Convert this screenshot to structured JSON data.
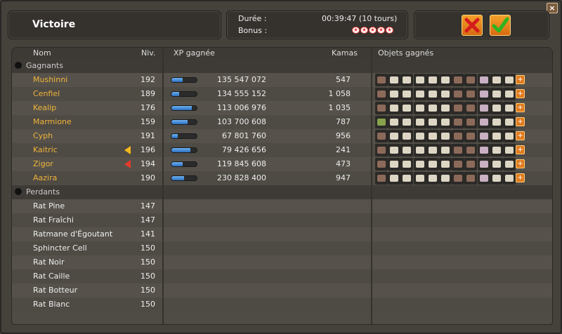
{
  "header": {
    "title": "Victoire",
    "duration_label": "Durée :",
    "duration_value": "00:39:47 (10 tours)",
    "bonus_label": "Bonus :",
    "stars": 5
  },
  "columns": {
    "name": "Nom",
    "level": "Niv.",
    "xp": "XP gagnée",
    "kamas": "Kamas",
    "items": "Objets gagnés"
  },
  "winners_label": "Gagnants",
  "losers_label": "Perdants",
  "winners": [
    {
      "name": "Mushinni",
      "level": "192",
      "xp": "135 547 072",
      "kamas": "547",
      "xp_fill": 0.45
    },
    {
      "name": "Cenfiel",
      "level": "189",
      "xp": "134 555 152",
      "kamas": "1 058",
      "xp_fill": 0.3
    },
    {
      "name": "Kealip",
      "level": "176",
      "xp": "113 006 976",
      "kamas": "1 035",
      "xp_fill": 0.8
    },
    {
      "name": "Marmione",
      "level": "159",
      "xp": "103 700 608",
      "kamas": "787",
      "xp_fill": 0.65
    },
    {
      "name": "Cyph",
      "level": "191",
      "xp": "67 801 760",
      "kamas": "956",
      "xp_fill": 0.25
    },
    {
      "name": "Kaitric",
      "level": "196",
      "xp": "79 426 656",
      "kamas": "241",
      "xp_fill": 0.75,
      "arrow": "yellow"
    },
    {
      "name": "Zigor",
      "level": "194",
      "xp": "119 845 608",
      "kamas": "473",
      "xp_fill": 0.45,
      "arrow": "red"
    },
    {
      "name": "Aazira",
      "level": "190",
      "xp": "230 828 400",
      "kamas": "947",
      "xp_fill": 0.5
    }
  ],
  "losers": [
    {
      "name": "Rat Pine",
      "level": "147"
    },
    {
      "name": "Rat Fraîchi",
      "level": "147"
    },
    {
      "name": "Ratmane d'Égoutant",
      "level": "141"
    },
    {
      "name": "Sphincter Cell",
      "level": "150"
    },
    {
      "name": "Rat Noir",
      "level": "150"
    },
    {
      "name": "Rat Caille",
      "level": "150"
    },
    {
      "name": "Rat Botteur",
      "level": "150"
    },
    {
      "name": "Rat Blanc",
      "level": "150"
    }
  ],
  "colors": {
    "winner_name": "#f0b43a",
    "xp_bar": "#2a6fc0"
  },
  "icons": {
    "close": "close-icon",
    "cancel": "red-cross-icon",
    "confirm": "green-check-icon",
    "winners": "trophy-icon",
    "losers": "skull-icon",
    "more_items": "orange-plus-icon"
  }
}
